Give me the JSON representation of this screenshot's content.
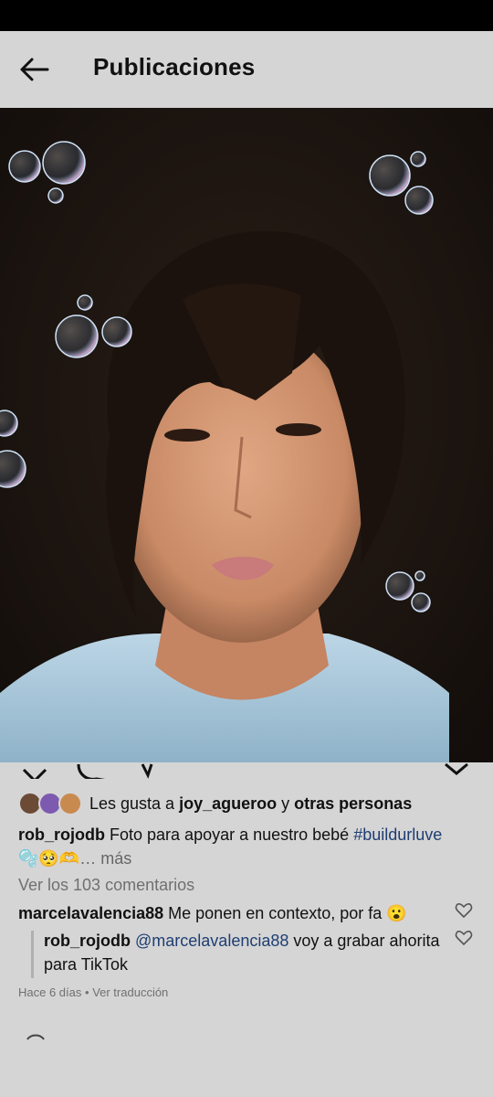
{
  "header": {
    "title": "Publicaciones"
  },
  "likes": {
    "prefix": "Les gusta a",
    "user": "joy_agueroo",
    "connector": "y",
    "others": "otras personas"
  },
  "caption": {
    "username": "rob_rojodb",
    "text": "Foto para apoyar a nuestro bebé",
    "hashtag": "#buildurluve",
    "emojis": "🫧🥺🫶",
    "more": "… más"
  },
  "view_comments": "Ver los 103 comentarios",
  "comment": {
    "username": "marcelavalencia88",
    "text": "Me ponen en contexto, por fa",
    "emoji": "😮"
  },
  "reply": {
    "username": "rob_rojodb",
    "mention": "@marcelavalencia88",
    "text": "voy a grabar ahorita para TikTok"
  },
  "meta": {
    "time": "Hace 6 días",
    "separator": "•",
    "translate": "Ver traducción"
  },
  "icons": {
    "back": "arrow-left-icon",
    "heart": "heart-outline-icon"
  }
}
